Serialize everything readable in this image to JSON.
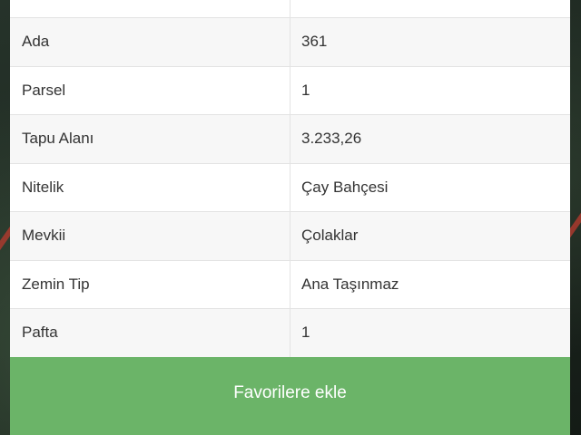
{
  "table": {
    "rows": [
      {
        "key": "",
        "value": ""
      },
      {
        "key": "Ada",
        "value": "361"
      },
      {
        "key": "Parsel",
        "value": "1"
      },
      {
        "key": "Tapu Alanı",
        "value": "3.233,26"
      },
      {
        "key": "Nitelik",
        "value": "Çay Bahçesi"
      },
      {
        "key": "Mevkii",
        "value": "Çolaklar"
      },
      {
        "key": "Zemin Tip",
        "value": "Ana Taşınmaz"
      },
      {
        "key": "Pafta",
        "value": "1"
      }
    ]
  },
  "actions": {
    "favorite_label": "Favorilere ekle"
  },
  "colors": {
    "button_green": "#6bb468",
    "row_alt": "#f7f7f7",
    "divider": "#e3e3e3"
  }
}
